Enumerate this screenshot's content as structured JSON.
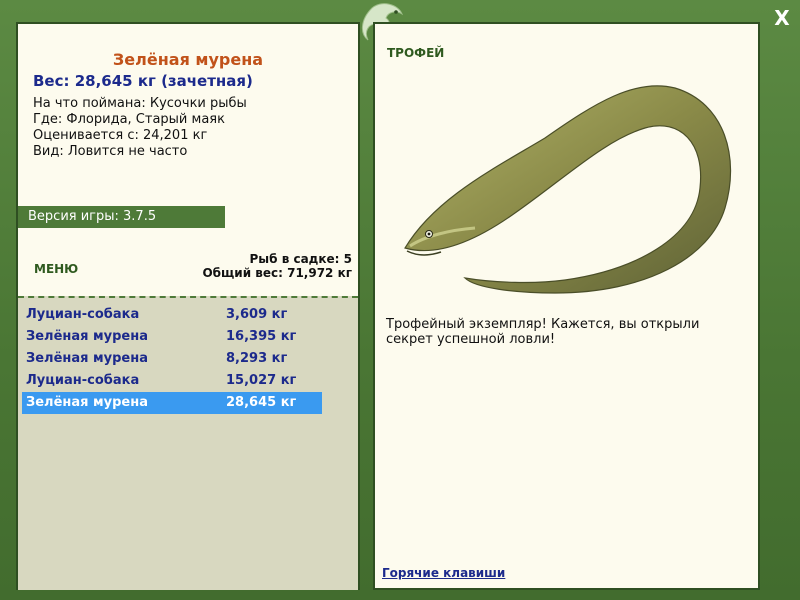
{
  "fish": {
    "name": "Зелёная мурена",
    "weight_line": "Вес: 28,645 кг (зачетная)",
    "bait_line": "На что поймана: Кусочки рыбы",
    "location_line": "Где: Флорида, Старый маяк",
    "valued_line": "Оценивается с: 24,201 кг",
    "kind_line": "Вид: Ловится не часто"
  },
  "version": "Версия игры: 3.7.5",
  "menu_label": "МЕНЮ",
  "keepnet": {
    "count_line": "Рыб в садке: 5",
    "total_line": "Общий вес: 71,972 кг"
  },
  "catches": [
    {
      "name": "Луциан-собака",
      "weight": "3,609 кг"
    },
    {
      "name": "Зелёная мурена",
      "weight": "16,395 кг"
    },
    {
      "name": "Зелёная мурена",
      "weight": "8,293 кг"
    },
    {
      "name": "Луциан-собака",
      "weight": "15,027 кг"
    },
    {
      "name": "Зелёная мурена",
      "weight": "28,645 кг"
    }
  ],
  "selected_catch_index": 4,
  "trophy_label": "ТРОФЕЙ",
  "trophy_text": "Трофейный экземпляр! Кажется, вы открыли секрет успешной ловли!",
  "hotkeys_label": "Горячие клавиши",
  "close_label": "X",
  "colors": {
    "frame_green": "#4e7a38",
    "panel_bg": "#fdfbee",
    "title_orange": "#c1521a",
    "text_blue": "#1c2a8c",
    "selected_row": "#3a9af0",
    "list_bg": "#d8d8c0"
  },
  "icons": [
    "lizard-logo-icon",
    "close-icon"
  ]
}
